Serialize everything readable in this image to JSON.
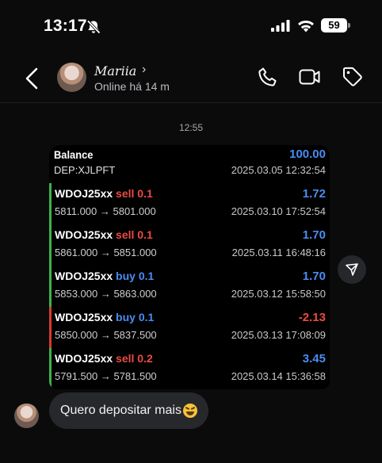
{
  "status_bar": {
    "time": "13:17",
    "battery": "59"
  },
  "header": {
    "contact_name": "Mariia",
    "name_chevron": "›",
    "contact_status": "Online há 14 m"
  },
  "chat": {
    "timestamp": "12:55",
    "card": {
      "balance": {
        "title": "Balance",
        "value": "100.00",
        "sub": "DEP:XJLPFT",
        "date": "2025.03.05 12:32:54"
      },
      "trades": [
        {
          "symbol": "WDOJ25xx",
          "side": "sell 0.1",
          "profit": "1.72",
          "prices": "5811.000 → 5801.000",
          "date": "2025.03.10 17:52:54"
        },
        {
          "symbol": "WDOJ25xx",
          "side": "sell 0.1",
          "profit": "1.70",
          "prices": "5861.000 → 5851.000",
          "date": "2025.03.11 16:48:16"
        },
        {
          "symbol": "WDOJ25xx",
          "side": "buy 0.1",
          "profit": "1.70",
          "prices": "5853.000 → 5863.000",
          "date": "2025.03.12 15:58:50"
        },
        {
          "symbol": "WDOJ25xx",
          "side": "buy 0.1",
          "profit": "-2.13",
          "prices": "5850.000 → 5837.500",
          "date": "2025.03.13 17:08:09"
        },
        {
          "symbol": "WDOJ25xx",
          "side": "sell 0.2",
          "profit": "3.45",
          "prices": "5791.500 → 5781.500",
          "date": "2025.03.14 15:36:58"
        }
      ]
    },
    "message": {
      "text": "Quero depositar mais",
      "emoji": "grinning-squinting-face-emoji"
    }
  },
  "colors": {
    "background": "#0b0b0c",
    "profit_blue": "#4a8cf2",
    "loss_red": "#ec4b43",
    "win_green": "#3fb24c",
    "bubble": "#26282c"
  }
}
